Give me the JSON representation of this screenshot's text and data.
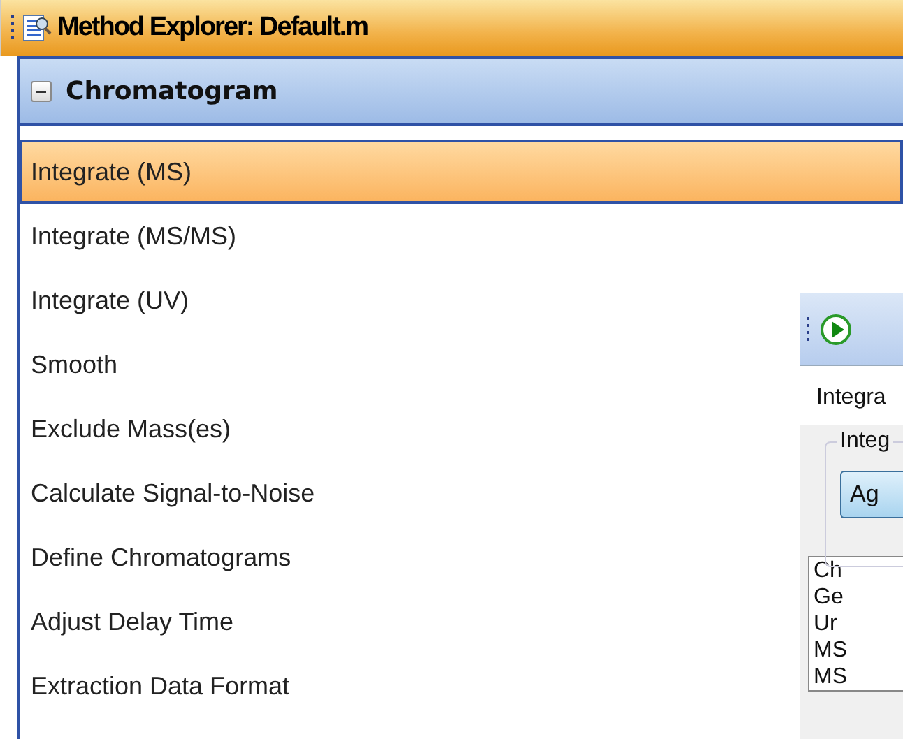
{
  "window": {
    "title": "Method Explorer: Default.m"
  },
  "section": {
    "title": "Chromatogram",
    "expanded": true,
    "items": [
      {
        "label": "Integrate (MS)",
        "selected": true
      },
      {
        "label": "Integrate (MS/MS)",
        "selected": false
      },
      {
        "label": "Integrate (UV)",
        "selected": false
      },
      {
        "label": "Smooth",
        "selected": false
      },
      {
        "label": "Exclude Mass(es)",
        "selected": false
      },
      {
        "label": "Calculate Signal-to-Noise",
        "selected": false
      },
      {
        "label": "Define Chromatograms",
        "selected": false
      },
      {
        "label": "Adjust Delay Time",
        "selected": false
      },
      {
        "label": "Extraction Data Format",
        "selected": false
      }
    ]
  },
  "side_window": {
    "heading": "Integra",
    "group_title": "Integ",
    "button": "Ag",
    "list": [
      "Ch",
      "Ge",
      "Ur",
      "MS",
      "MS"
    ]
  }
}
